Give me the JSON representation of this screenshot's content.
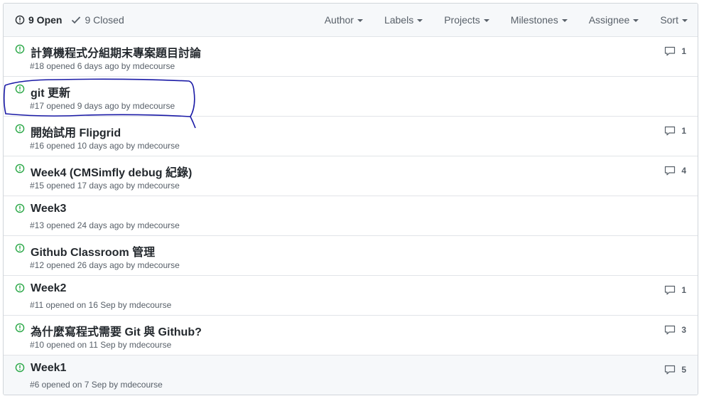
{
  "header": {
    "open_label": "9 Open",
    "closed_label": "9 Closed",
    "filters": [
      "Author",
      "Labels",
      "Projects",
      "Milestones",
      "Assignee",
      "Sort"
    ]
  },
  "issues": [
    {
      "title": "計算機程式分組期末專案題目討論",
      "meta": "#18 opened 6 days ago by mdecourse",
      "comments": "1"
    },
    {
      "title": "git 更新",
      "meta": "#17 opened 9 days ago by mdecourse",
      "comments": ""
    },
    {
      "title": "開始試用 Flipgrid",
      "meta": "#16 opened 10 days ago by mdecourse",
      "comments": "1"
    },
    {
      "title": "Week4 (CMSimfly debug 紀錄)",
      "meta": "#15 opened 17 days ago by mdecourse",
      "comments": "4"
    },
    {
      "title": "Week3",
      "meta": "#13 opened 24 days ago by mdecourse",
      "comments": ""
    },
    {
      "title": "Github Classroom 管理",
      "meta": "#12 opened 26 days ago by mdecourse",
      "comments": ""
    },
    {
      "title": "Week2",
      "meta": "#11 opened on 16 Sep by mdecourse",
      "comments": "1"
    },
    {
      "title": "為什麼寫程式需要 Git 與 Github?",
      "meta": "#10 opened on 11 Sep by mdecourse",
      "comments": "3"
    },
    {
      "title": "Week1",
      "meta": "#6 opened on 7 Sep by mdecourse",
      "comments": "5"
    }
  ],
  "colors": {
    "open_icon": "#28a745",
    "annotation": "#1a1aa6",
    "header_bg": "#f6f8fa",
    "border": "#e1e4e8"
  }
}
